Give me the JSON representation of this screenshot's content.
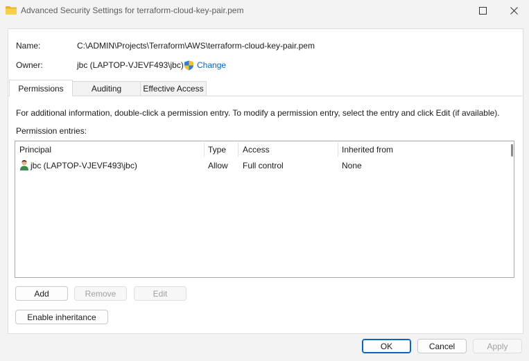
{
  "window": {
    "title": "Advanced Security Settings for terraform-cloud-key-pair.pem"
  },
  "info": {
    "name_label": "Name:",
    "name_value": "C:\\ADMIN\\Projects\\Terraform\\AWS\\terraform-cloud-key-pair.pem",
    "owner_label": "Owner:",
    "owner_value": "jbc (LAPTOP-VJEVF493\\jbc)",
    "change_link": "Change"
  },
  "tabs": [
    {
      "label": "Permissions",
      "active": true
    },
    {
      "label": "Auditing",
      "active": false
    },
    {
      "label": "Effective Access",
      "active": false
    }
  ],
  "permissions": {
    "instructions": "For additional information, double-click a permission entry. To modify a permission entry, select the entry and click Edit (if available).",
    "entries_label": "Permission entries:",
    "columns": [
      "Principal",
      "Type",
      "Access",
      "Inherited from"
    ],
    "rows": [
      {
        "principal": "jbc (LAPTOP-VJEVF493\\jbc)",
        "type": "Allow",
        "access": "Full control",
        "inherited_from": "None"
      }
    ]
  },
  "buttons": {
    "add": "Add",
    "remove": "Remove",
    "edit": "Edit",
    "enable_inheritance": "Enable inheritance",
    "ok": "OK",
    "cancel": "Cancel",
    "apply": "Apply"
  },
  "icons": {
    "title": "folder-icon",
    "owner_change": "uac-shield-icon",
    "principal": "user-icon"
  },
  "colors": {
    "link": "#0066cc",
    "primary_border": "#0067c0",
    "disabled_text": "#a0a0a0"
  }
}
